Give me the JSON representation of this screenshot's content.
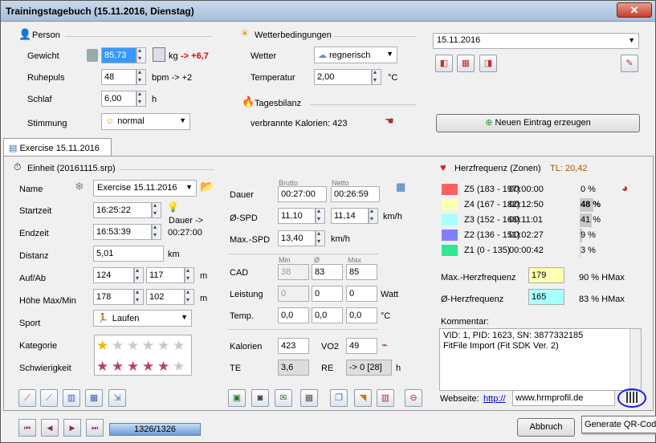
{
  "window": {
    "title": "Trainingstagebuch (15.11.2016, Dienstag)",
    "close": "✕"
  },
  "person": {
    "header": "Person",
    "gewicht_label": "Gewicht",
    "gewicht_value": "85,73",
    "gewicht_unit": "kg",
    "gewicht_delta": "-> +6,7",
    "ruhepuls_label": "Ruhepuls",
    "ruhepuls_value": "48",
    "ruhepuls_unit": "bpm  -> +2",
    "schlaf_label": "Schlaf",
    "schlaf_value": "6,00",
    "schlaf_unit": "h",
    "stimmung_label": "Stimmung",
    "stimmung_value": "normal"
  },
  "wetter": {
    "header": "Wetterbedingungen",
    "wetter_label": "Wetter",
    "wetter_value": "regnerisch",
    "temperatur_label": "Temperatur",
    "temperatur_value": "2,00",
    "temperatur_unit": "°C"
  },
  "tagesbilanz": {
    "header": "Tagesbilanz",
    "kalorien_text": "verbrannte Kalorien: 423"
  },
  "date": {
    "value": "15.11.2016"
  },
  "neuer_eintrag": "Neuen Eintrag erzeugen",
  "tab": {
    "label": "Exercise 15.11.2016"
  },
  "einheit": {
    "header": "Einheit (20161115.srp)",
    "name_label": "Name",
    "name_value": "Exercise 15.11.2016",
    "startzeit_label": "Startzeit",
    "startzeit_value": "16:25:22",
    "dauer_hint": "Dauer ->",
    "dauer_hint_value": "00:27:00",
    "endzeit_label": "Endzeit",
    "endzeit_value": "16:53:39",
    "distanz_label": "Distanz",
    "distanz_value": "5,01",
    "distanz_unit": "km",
    "aufab_label": "Auf/Ab",
    "auf_value": "124",
    "ab_value": "117",
    "aufab_unit": "m",
    "hoehe_label": "Höhe Max/Min",
    "hoehe_max": "178",
    "hoehe_min": "102",
    "hoehe_unit": "m",
    "sport_label": "Sport",
    "sport_value": "Laufen",
    "kategorie_label": "Kategorie",
    "schwierigkeit_label": "Schwierigkeit",
    "kategorie_stars": 1,
    "schwierigkeit_stars": 5,
    "stars_total": 6
  },
  "metrics": {
    "brutto": "Brutto",
    "netto": "Netto",
    "dauer_label": "Dauer",
    "dauer_brutto": "00:27:00",
    "dauer_netto": "00:26:59",
    "spd_label": "Ø-SPD",
    "spd_brutto": "11,10",
    "spd_netto": "11,14",
    "spd_unit": "km/h",
    "maxspd_label": "Max.-SPD",
    "maxspd_value": "13,40",
    "maxspd_unit": "km/h",
    "min": "Min",
    "avg": "Ø",
    "max": "Max",
    "cad_label": "CAD",
    "cad_min": "38",
    "cad_avg": "83",
    "cad_max": "85",
    "leistung_label": "Leistung",
    "leistung_min": "0",
    "leistung_avg": "0",
    "leistung_max": "0",
    "leistung_unit": "Watt",
    "temp_label": "Temp.",
    "temp_min": "0,0",
    "temp_avg": "0,0",
    "temp_max": "0,0",
    "temp_unit": "°C",
    "kalorien_label": "Kalorien",
    "kalorien_value": "423",
    "vo2_label": "VO2",
    "vo2_value": "49",
    "te_label": "TE",
    "te_value": "3,6",
    "re_label": "RE",
    "re_value": "-> 0 [28]",
    "re_unit": "h"
  },
  "herz": {
    "header": "Herzfrequenz (Zonen)",
    "tl": "TL: 20,42",
    "zones": [
      {
        "name": "Z5 (183 - 197)",
        "time": "00:00:00",
        "pct": "0 %",
        "color": "#ff6060",
        "fill": 0
      },
      {
        "name": "Z4 (167 - 182)",
        "time": "00:12:50",
        "pct": "48 %",
        "color": "#ffffb0",
        "fill": 0.48
      },
      {
        "name": "Z3 (152 - 166)",
        "time": "00:11:01",
        "pct": "41 %",
        "color": "#a8ffff",
        "fill": 0.41
      },
      {
        "name": "Z2 (136 - 151)",
        "time": "00:02:27",
        "pct": "9 %",
        "color": "#8080ff",
        "fill": 0.09
      },
      {
        "name": "Z1 (0 - 135)",
        "time": "00:00:42",
        "pct": "3 %",
        "color": "#30e890",
        "fill": 0.03
      }
    ],
    "max_label": "Max.-Herzfrequenz",
    "max_value": "179",
    "max_pct": "90 % HMax",
    "avg_label": "Ø-Herzfrequenz",
    "avg_value": "165",
    "avg_pct": "83 % HMax",
    "max_color": "#ffffb0",
    "avg_color": "#a8ffff"
  },
  "kommentar": {
    "label": "Kommentar:",
    "line1": "VID: 1, PID: 1623, SN: 3877332185",
    "line2": "FitFile Import (Fit SDK Ver. 2)"
  },
  "webseite": {
    "label": "Webseite:",
    "protocol": "http://",
    "url": "www.hrmprofil.de"
  },
  "footer": {
    "counter": "1326/1326",
    "abbruch": "Abbruch",
    "tooltip": "Generate QR-Code"
  }
}
